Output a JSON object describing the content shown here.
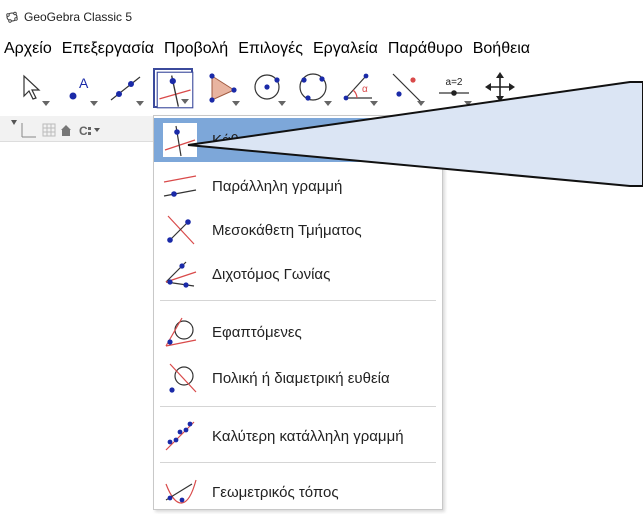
{
  "window": {
    "title": "GeoGebra Classic 5"
  },
  "menubar": {
    "items": [
      {
        "label": "Αρχείο"
      },
      {
        "label": "Επεξεργασία"
      },
      {
        "label": "Προβολή"
      },
      {
        "label": "Επιλογές"
      },
      {
        "label": "Εργαλεία"
      },
      {
        "label": "Παράθυρο"
      },
      {
        "label": "Βοήθεια"
      }
    ]
  },
  "toolbar": {
    "tools": [
      {
        "icon": "pointer-arrow-icon"
      },
      {
        "icon": "point-A-icon",
        "point_label": "A"
      },
      {
        "icon": "line-through-two-points-icon"
      },
      {
        "icon": "perpendicular-line-icon",
        "selected": true
      },
      {
        "icon": "polygon-icon"
      },
      {
        "icon": "circle-center-point-icon"
      },
      {
        "icon": "circle-three-points-icon"
      },
      {
        "icon": "angle-icon",
        "angle_label": "α"
      },
      {
        "icon": "reflect-about-line-icon"
      },
      {
        "icon": "slider-icon",
        "slider_label": "a=2"
      },
      {
        "icon": "move-graphics-view-icon"
      }
    ]
  },
  "dropdown": {
    "items": [
      {
        "label": "Κάθ",
        "icon": "perpendicular-line-icon",
        "highlighted": true
      },
      {
        "label": "Παράλληλη γραμμή",
        "icon": "parallel-line-icon"
      },
      {
        "label": "Μεσοκάθετη Τμήματος",
        "icon": "perpendicular-bisector-icon"
      },
      {
        "label": "Διχοτόμος Γωνίας",
        "icon": "angle-bisector-icon"
      },
      {
        "label": "Εφαπτόμενες",
        "icon": "tangents-icon"
      },
      {
        "label": "Πολική ή διαμετρική ευθεία",
        "icon": "polar-line-icon"
      },
      {
        "label": "Καλύτερη κατάλληλη γραμμή",
        "icon": "best-fit-line-icon"
      },
      {
        "label": "Γεωμετρικός τόπος",
        "icon": "locus-icon"
      }
    ]
  },
  "colors": {
    "selected_border": "#3b4a9c",
    "highlight": "#7da7d9",
    "tooltip_fill": "#dbe5f4",
    "point_blue": "#1a2aa8",
    "line_red": "#d94a4a"
  }
}
